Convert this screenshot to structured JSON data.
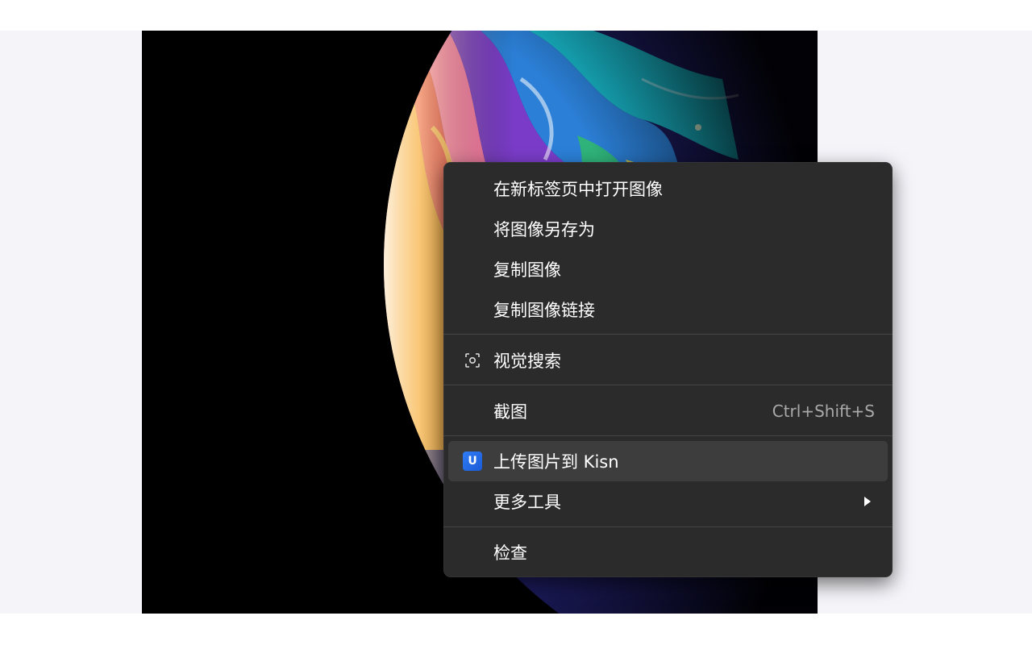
{
  "menu": {
    "items": [
      {
        "label": "在新标签页中打开图像"
      },
      {
        "label": "将图像另存为"
      },
      {
        "label": "复制图像"
      },
      {
        "label": "复制图像链接"
      },
      {
        "label": "视觉搜索",
        "icon": "visual-search-icon"
      },
      {
        "label": "截图",
        "shortcut": "Ctrl+Shift+S"
      },
      {
        "label": "上传图片到 Kisn",
        "icon": "kisn-logo-icon",
        "icon_text": "U",
        "highlighted": true
      },
      {
        "label": "更多工具",
        "submenu": true
      },
      {
        "label": "检查"
      }
    ]
  },
  "colors": {
    "menu_background": "#2b2b2b",
    "highlight": "#3d3d3d",
    "viewer_background": "#000000",
    "page_background": "#f4f4f9"
  }
}
